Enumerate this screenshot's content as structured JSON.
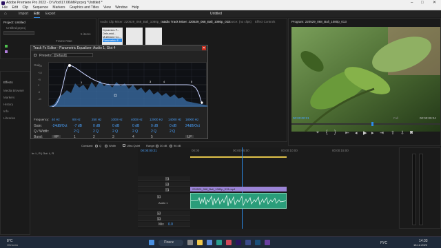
{
  "app": {
    "title": "Adobe Premiere Pro 2023 - D:\\Vlod\\17.06\\MiP.prproj *Untitled *"
  },
  "menu": [
    "File",
    "Edit",
    "Clip",
    "Sequence",
    "Markers",
    "Graphics and Titles",
    "View",
    "Window",
    "Help"
  ],
  "workspaces": {
    "home": "⌂",
    "import": "Import",
    "edit": "Edit",
    "export": "Export",
    "center": "Untitled"
  },
  "project": {
    "title": "Project: Untitled",
    "file": "Untitled.prproj",
    "items_label": "5 items",
    "frame_rate_label": "Frame Rate",
    "clip_name": "220529_068_...",
    "rate": "59.94 fps"
  },
  "left_tabs": [
    "Effects",
    "Media Browser",
    "Markers",
    "History",
    "Info",
    "Libraries"
  ],
  "mixer_tabs": [
    "Audio Clip Mixer: 220529_068_Bali_1080p_013",
    "Audio Track Mixer: 220529_068_Bali_1080p_013",
    "Source: (no clips)",
    "Effect Controls"
  ],
  "effects_list": [
    "Dynamics P...",
    "Dehumid...",
    "Multiband Co...",
    "Parametric E..."
  ],
  "program": {
    "title": "Program: 220529_068_Bali_1080p_013",
    "timecode_left": "00:00:00:21",
    "timecode_right": "00:00:09:24",
    "fit": "Full",
    "timecode_small": "00:00:09:24"
  },
  "dialog": {
    "title": "Track Fx Editor - Parametric Equalizer: Audio 1, Slot 4",
    "presets_label": "Presets:",
    "preset_value": "[Default]",
    "gain_db": "Gain",
    "freq_labels": [
      "20",
      "50",
      "100",
      "200",
      "500",
      "1k",
      "2k",
      "5k",
      "10k",
      "20k"
    ],
    "db_labels": [
      "+15",
      "+10",
      "+5",
      "0",
      "-5",
      "-10",
      "-15"
    ],
    "params": {
      "frequency_label": "Frequency:",
      "gain_label": "Gain:",
      "q_label": "Q / Width:",
      "band_label": "Band:",
      "freqs": [
        "40 Hz",
        "90 Hz",
        "250 Hz",
        "1000 Hz",
        "4000 Hz",
        "12000 Hz",
        "14000 Hz",
        "18000 Hz"
      ],
      "gains": [
        "-24dB/Oct",
        "-7 dB",
        "0 dB",
        "0 dB",
        "0 dB",
        "0 dB",
        "0 dB",
        "24dB/Oct"
      ],
      "qs": [
        "",
        "2 Q",
        "2 Q",
        "2 Q",
        "2 Q",
        "2 Q",
        "2 Q",
        ""
      ],
      "band_buttons": [
        "HP",
        "1",
        "2",
        "3",
        "4",
        "5",
        "LP"
      ],
      "bands_selected": "HP"
    },
    "constant_label": "Constant:",
    "constant_q": "Q",
    "constant_width": "Width",
    "ultra_quiet": "Ultra Quiet",
    "range_label": "Range:",
    "range_30": "30 dB",
    "range_96": "96 dB",
    "footer": "In: L, R | Out: L, R"
  },
  "timeline": {
    "timecode": "00:00:00:21",
    "ruler": [
      "00:00",
      "00:00:05:00",
      "00:00:10:00",
      "00:00:15:00"
    ],
    "video_clip": "220529_068_Bali_1080p_013.mp4",
    "tracks_video": [
      "V3",
      "V2",
      "V1"
    ],
    "tracks_audio": [
      "A1",
      "A2",
      "A3"
    ],
    "audio_track_name": "Audio 1",
    "mix_label": "Mix",
    "mix_value": "0.0"
  },
  "taskbar": {
    "weather": "8°C",
    "weather_sub": "Облачно",
    "search": "Поиск",
    "lang": "РУС",
    "time": "14:33",
    "date": "18.12.2022"
  },
  "colors": {
    "accent": "#2d8ceb",
    "eq_curve": "#c9d3ff",
    "video_clip": "#9b84d6",
    "audio_clip": "#2a9d7a",
    "dialog_bg": "#232323"
  }
}
